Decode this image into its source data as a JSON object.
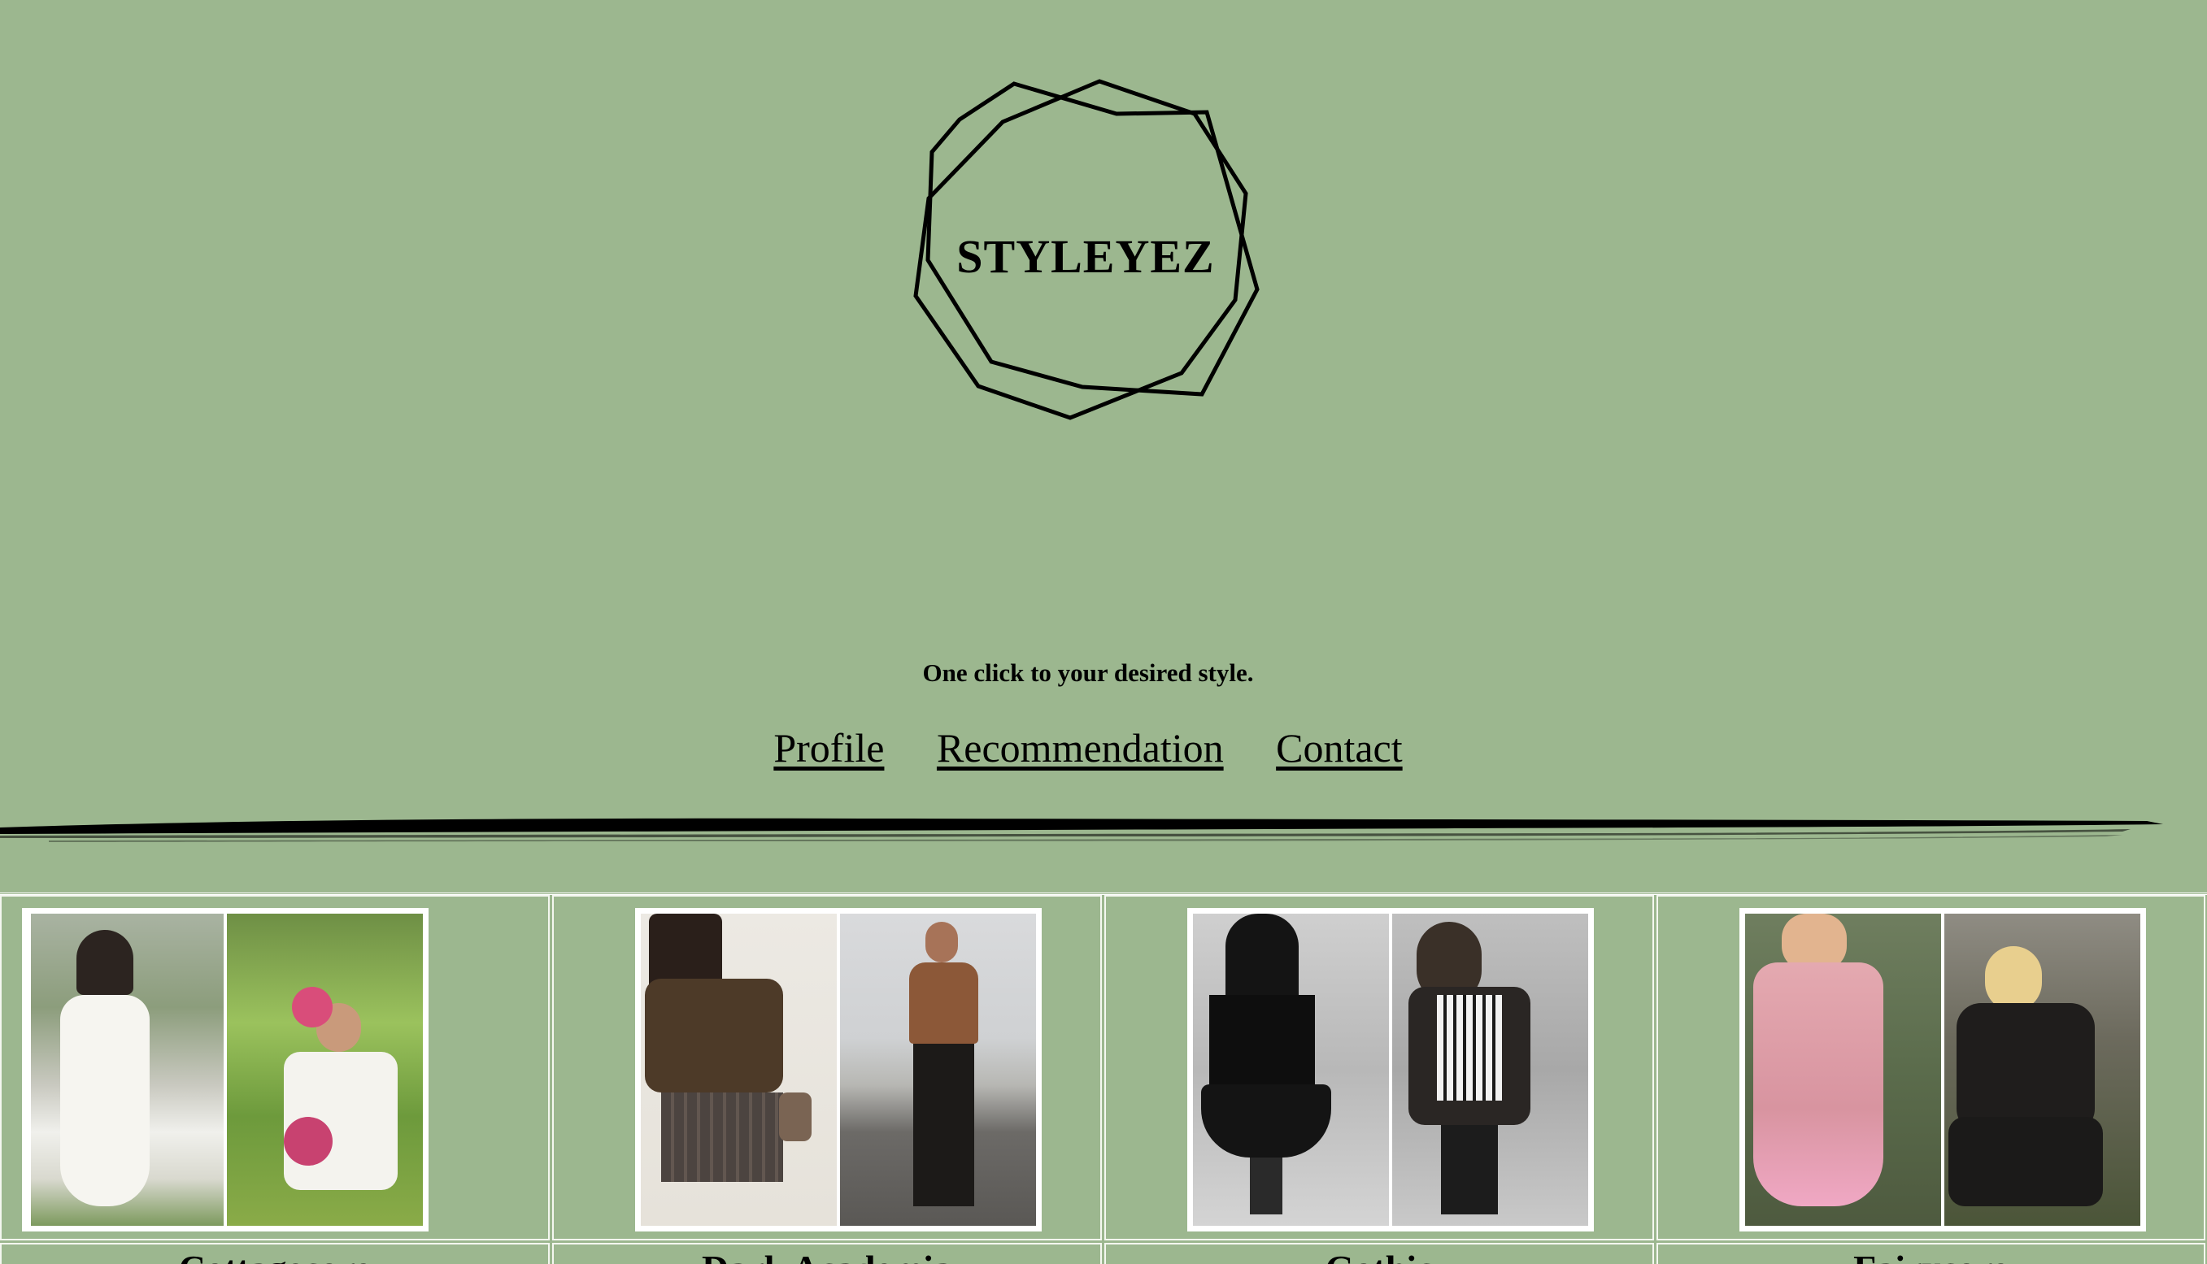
{
  "brand": {
    "name": "STYLEYEZ"
  },
  "tagline": "One click to your desired style.",
  "nav": {
    "items": [
      {
        "label": "Profile"
      },
      {
        "label": "Recommendation"
      },
      {
        "label": "Contact"
      }
    ]
  },
  "categories": [
    {
      "label": "Cottagecore",
      "photo_left": "woman in white lace dress in a garden",
      "photo_right": "man in white shirt holding pink flowers"
    },
    {
      "label": "Dark Academia",
      "photo_left": "woman in brown blouse and plaid skirt",
      "photo_right": "man in brown sweater by a river"
    },
    {
      "label": "Gothic",
      "photo_left": "woman in black dress and fishnets",
      "photo_right": "man in skull print shirt"
    },
    {
      "label": "Fairycore",
      "photo_left": "woman in pink ruffled dress",
      "photo_right": "man in black clothing in a forest"
    }
  ],
  "colors": {
    "background": "#9cb78f",
    "text": "#000000",
    "frame": "#ffffff"
  }
}
